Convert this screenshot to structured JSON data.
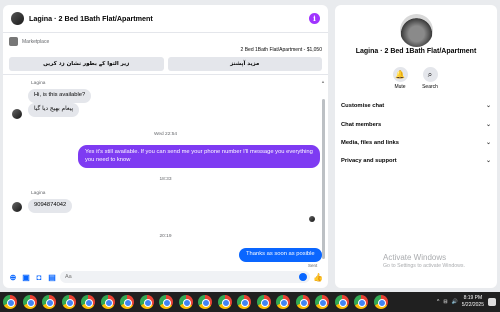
{
  "chat": {
    "title": "Lagina · 2 Bed 1Bath Flat/Apartment",
    "marketplace_label": "Marketplace",
    "listing": "2 Bed 1Bath Flat/Apartment - $1,050",
    "quick_buttons": [
      "زیر التوا کے بطور نشان زد کریں",
      "مزید آپشنز"
    ],
    "messages": {
      "sender1": "Lagina",
      "in1": "Hi, is this available?",
      "in2": "پیغام بھیج دیا گیا",
      "ts1": "Wed 22:54",
      "out1": "Yes it's still available. If you can send me your phone number I'll message you everything you need to know",
      "ts2": "18:33",
      "sender2": "Lagina",
      "in3": "9094874042",
      "ts3": "20:19",
      "out2": "Thanks as soon as posible",
      "sent": "Sent"
    },
    "composer": {
      "placeholder": "Aa"
    }
  },
  "info": {
    "title": "Lagina · 2 Bed 1Bath Flat/Apartment",
    "mute": "Mute",
    "search": "Search",
    "sections": [
      "Customise chat",
      "Chat members",
      "Media, files and links",
      "Privacy and support"
    ],
    "watermark1": "Activate Windows",
    "watermark2": "Go to Settings to activate Windows."
  },
  "taskbar": {
    "time": "8:19 PM",
    "date": "5/22/2025",
    "icons": [
      "chrome-icon",
      "chrome-icon",
      "chrome-icon",
      "chrome-icon",
      "chrome-icon",
      "chrome-icon",
      "chrome-icon",
      "chrome-icon",
      "chrome-icon",
      "chrome-icon",
      "chrome-icon",
      "chrome-icon",
      "chrome-icon",
      "chrome-icon",
      "chrome-icon",
      "chrome-icon",
      "chrome-icon",
      "chrome-icon",
      "chrome-icon",
      "chrome-icon"
    ]
  },
  "colors": {
    "accent": "#a033ff",
    "outgoing": "#7e3bf2",
    "blue": "#0a66ff"
  }
}
